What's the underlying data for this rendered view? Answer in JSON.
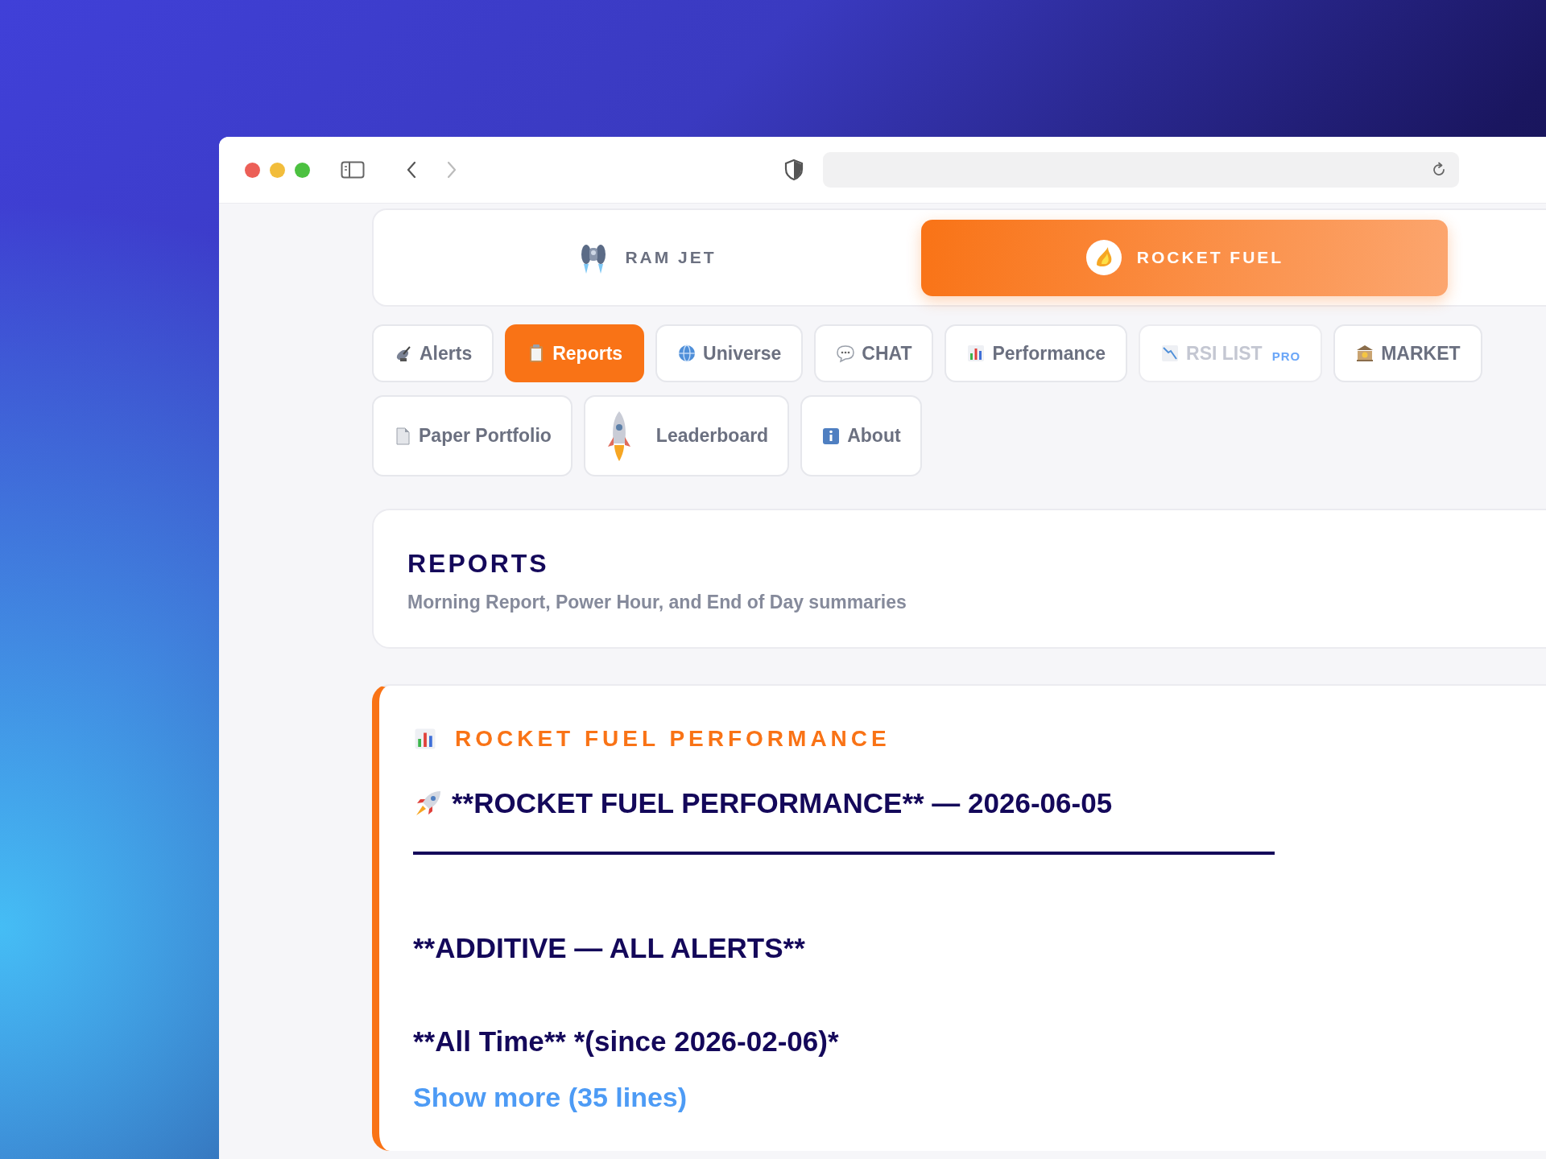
{
  "toolbar": {
    "back_enabled": true,
    "forward_enabled": false
  },
  "mode_tabs": [
    {
      "label": "RAM JET",
      "selected": false
    },
    {
      "label": "ROCKET FUEL",
      "selected": true
    }
  ],
  "nav_rows": [
    [
      {
        "label": "Alerts",
        "selected": false,
        "disabled": false
      },
      {
        "label": "Reports",
        "selected": true,
        "disabled": false
      },
      {
        "label": "Universe",
        "selected": false,
        "disabled": false
      },
      {
        "label": "CHAT",
        "selected": false,
        "disabled": false
      },
      {
        "label": "Performance",
        "selected": false,
        "disabled": false
      },
      {
        "label": "RSI LIST",
        "badge": "PRO",
        "selected": false,
        "disabled": true
      },
      {
        "label": "MARKET",
        "selected": false,
        "disabled": false
      }
    ],
    [
      {
        "label": "Paper Portfolio",
        "selected": false,
        "disabled": false
      },
      {
        "label": "Leaderboard",
        "selected": false,
        "disabled": false
      },
      {
        "label": "About",
        "selected": false,
        "disabled": false
      }
    ]
  ],
  "page_header": {
    "title": "REPORTS",
    "subtitle": "Morning Report, Power Hour, and End of Day summaries"
  },
  "report": {
    "section_title": "ROCKET FUEL PERFORMANCE",
    "lines": [
      {
        "kind": "heading",
        "text": "**ROCKET FUEL PERFORMANCE** — 2026-06-05"
      },
      {
        "kind": "rule"
      },
      {
        "kind": "subheading",
        "text": "**ADDITIVE — ALL ALERTS**"
      },
      {
        "kind": "subheading",
        "text": "**All Time** *(since 2026-02-06)*"
      }
    ],
    "show_more": "Show more (35 lines)"
  }
}
